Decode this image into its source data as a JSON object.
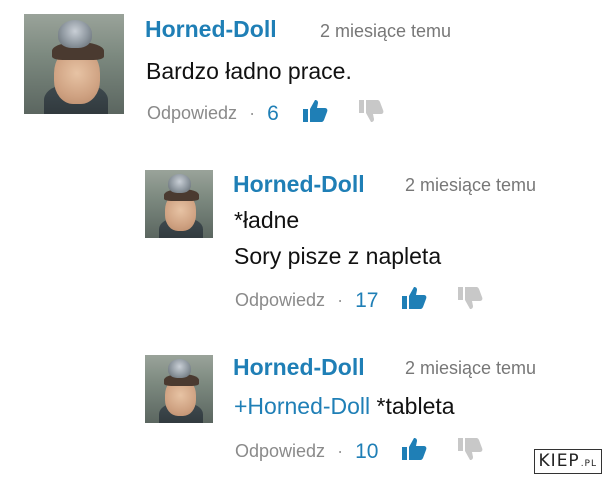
{
  "comments": [
    {
      "author": "Horned-Doll",
      "time": "2 miesiące temu",
      "lines": [
        "Bardzo ładno prace."
      ],
      "reply_label": "Odpowiedz",
      "separator": "·",
      "likes": "6"
    },
    {
      "author": "Horned-Doll",
      "time": "2 miesiące temu",
      "lines": [
        "*ładne",
        "Sory pisze z napleta"
      ],
      "reply_label": "Odpowiedz",
      "separator": "·",
      "likes": "17"
    },
    {
      "author": "Horned-Doll",
      "time": "2 miesiące temu",
      "mention": "+Horned-Doll",
      "text_after_mention": " *tableta",
      "reply_label": "Odpowiedz",
      "separator": "·",
      "likes": "10"
    }
  ],
  "icons": {
    "like": "thumbs-up-icon",
    "dislike": "thumbs-down-icon"
  },
  "colors": {
    "author": "#1f7fb6",
    "like_icon": "#1f7fb6",
    "dislike_icon": "#c8c8c8"
  },
  "watermark": {
    "text": "KIEP",
    "suffix": ".PL"
  }
}
